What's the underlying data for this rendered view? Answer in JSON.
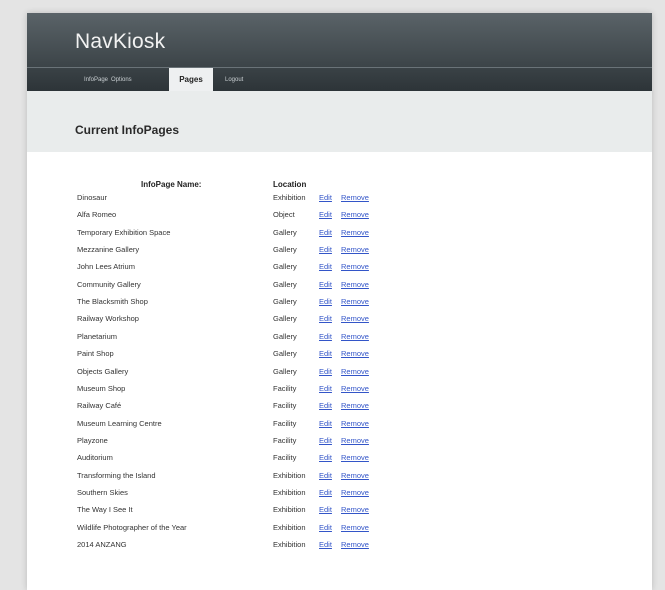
{
  "header": {
    "title": "NavKiosk"
  },
  "nav": {
    "items": [
      {
        "label": "InfoPage"
      },
      {
        "label": "Options"
      },
      {
        "label": "Pages"
      },
      {
        "label": "Logout"
      }
    ],
    "active": "Pages"
  },
  "section": {
    "title": "Current InfoPages"
  },
  "table": {
    "columns": {
      "name": "InfoPage Name:",
      "location": "Location"
    },
    "edit_label": "Edit",
    "remove_label": "Remove",
    "rows": [
      {
        "name": "Dinosaur",
        "location": "Exhibition"
      },
      {
        "name": "Alfa Romeo",
        "location": "Object"
      },
      {
        "name": "Temporary Exhibition Space",
        "location": "Gallery"
      },
      {
        "name": "Mezzanine Gallery",
        "location": "Gallery"
      },
      {
        "name": "John Lees Atrium",
        "location": "Gallery"
      },
      {
        "name": "Community Gallery",
        "location": "Gallery"
      },
      {
        "name": "The Blacksmith Shop",
        "location": "Gallery"
      },
      {
        "name": "Railway Workshop",
        "location": "Gallery"
      },
      {
        "name": "Planetarium",
        "location": "Gallery"
      },
      {
        "name": "Paint Shop",
        "location": "Gallery"
      },
      {
        "name": "Objects Gallery",
        "location": "Gallery"
      },
      {
        "name": "Museum Shop",
        "location": "Facility"
      },
      {
        "name": "Railway Café",
        "location": "Facility"
      },
      {
        "name": "Museum Learning Centre",
        "location": "Facility"
      },
      {
        "name": "Playzone",
        "location": "Facility"
      },
      {
        "name": "Auditorium",
        "location": "Facility"
      },
      {
        "name": "Transforming the Island",
        "location": "Exhibition"
      },
      {
        "name": "Southern Skies",
        "location": "Exhibition"
      },
      {
        "name": "The Way I See It",
        "location": "Exhibition"
      },
      {
        "name": "Wildlife Photographer of the Year",
        "location": "Exhibition"
      },
      {
        "name": "2014 ANZANG",
        "location": "Exhibition"
      }
    ]
  }
}
